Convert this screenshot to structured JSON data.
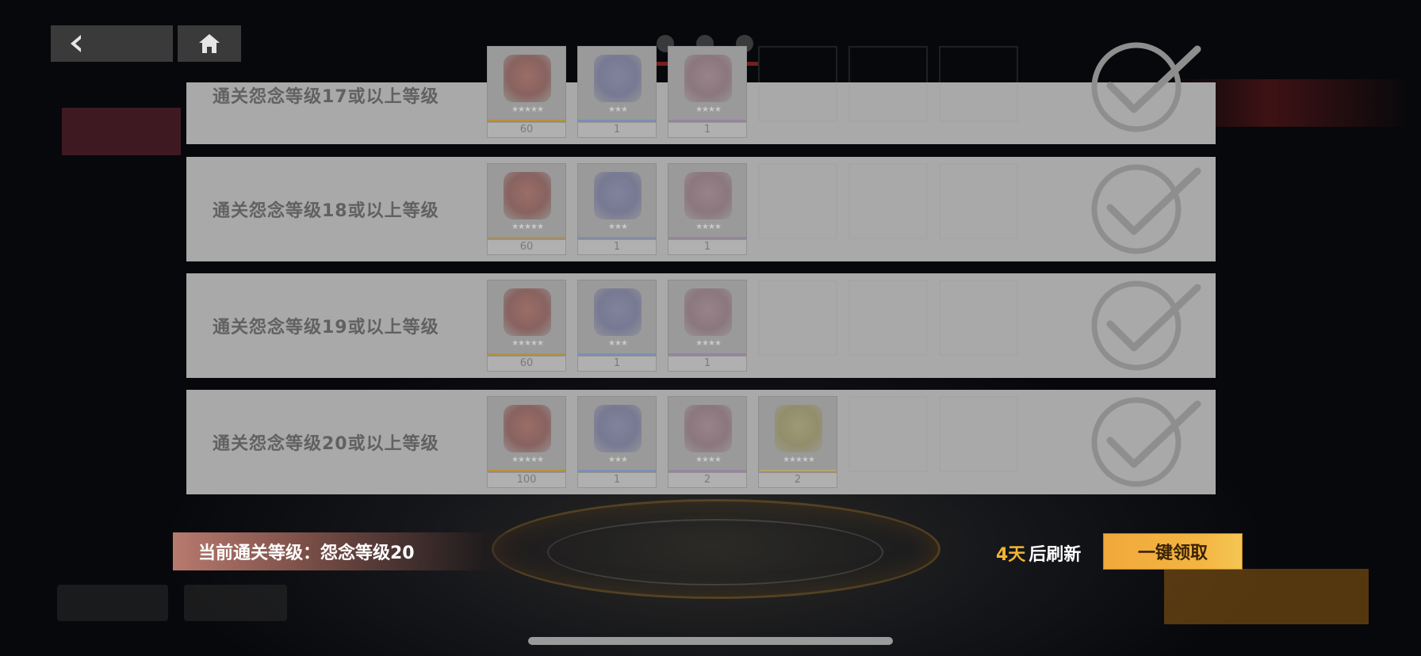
{
  "nav": {
    "back_icon": "chevron-left-icon",
    "home_icon": "home-icon"
  },
  "rows": [
    {
      "label": "通关怨念等级17或以上等级",
      "rewards": [
        {
          "qty": "60",
          "art": "red",
          "bar": "orange",
          "stars": "★★★★★"
        },
        {
          "qty": "1",
          "art": "blue",
          "bar": "blue",
          "stars": "★★★"
        },
        {
          "qty": "1",
          "art": "pink",
          "bar": "purple",
          "stars": "★★★★"
        }
      ],
      "claimed": true
    },
    {
      "label": "通关怨念等级18或以上等级",
      "rewards": [
        {
          "qty": "60",
          "art": "red",
          "bar": "orange",
          "stars": "★★★★★"
        },
        {
          "qty": "1",
          "art": "blue",
          "bar": "blue",
          "stars": "★★★"
        },
        {
          "qty": "1",
          "art": "pink",
          "bar": "purple",
          "stars": "★★★★"
        }
      ],
      "claimed": true
    },
    {
      "label": "通关怨念等级19或以上等级",
      "rewards": [
        {
          "qty": "60",
          "art": "red",
          "bar": "orange",
          "stars": "★★★★★"
        },
        {
          "qty": "1",
          "art": "blue",
          "bar": "blue",
          "stars": "★★★"
        },
        {
          "qty": "1",
          "art": "pink",
          "bar": "purple",
          "stars": "★★★★"
        }
      ],
      "claimed": true
    },
    {
      "label": "通关怨念等级20或以上等级",
      "rewards": [
        {
          "qty": "100",
          "art": "red",
          "bar": "orange",
          "stars": "★★★★★"
        },
        {
          "qty": "1",
          "art": "blue",
          "bar": "blue",
          "stars": "★★★"
        },
        {
          "qty": "2",
          "art": "pink",
          "bar": "purple",
          "stars": "★★★★"
        },
        {
          "qty": "2",
          "art": "gold",
          "bar": "yellow",
          "stars": "★★★★★"
        }
      ],
      "claimed": true
    }
  ],
  "footer": {
    "current_level": "当前通关等级：怨念等级20",
    "refresh_days": "4天",
    "refresh_suffix": "后刷新",
    "claim_all_label": "一键领取"
  },
  "colors": {
    "accent_gold": "#f2b533",
    "claim_button": "#f3b542",
    "row_bg": "#a9a9a9"
  }
}
